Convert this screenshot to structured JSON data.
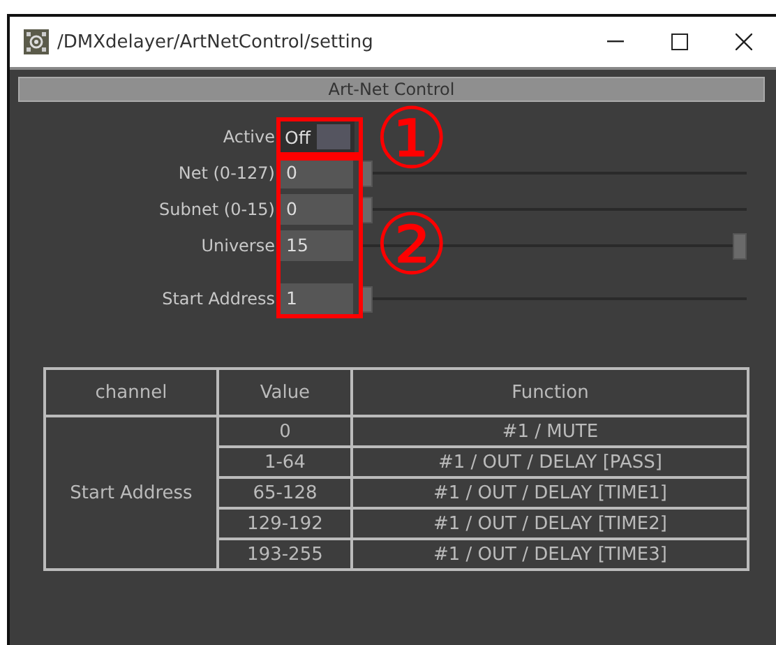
{
  "window": {
    "title": "/DMXdelayer/ArtNetControl/setting"
  },
  "panel": {
    "title": "Art-Net Control"
  },
  "active": {
    "label": "Active",
    "value": "Off",
    "on": false
  },
  "fields": [
    {
      "label": "Net (0-127)",
      "value": "0",
      "level": 0
    },
    {
      "label": "Subnet (0-15)",
      "value": "0",
      "level": 0
    },
    {
      "label": "Universe",
      "value": "15",
      "level": 1
    },
    {
      "label": "Start Address",
      "value": "1",
      "level": 0
    }
  ],
  "table": {
    "columns": [
      "channel",
      "Value",
      "Function"
    ],
    "group": "Start Address",
    "rows": [
      {
        "value": "0",
        "function": "#1 / MUTE"
      },
      {
        "value": "1-64",
        "function": "#1 / OUT / DELAY [PASS]"
      },
      {
        "value": "65-128",
        "function": "#1 / OUT / DELAY [TIME1]"
      },
      {
        "value": "129-192",
        "function": "#1 / OUT / DELAY [TIME2]"
      },
      {
        "value": "193-255",
        "function": "#1 / OUT / DELAY [TIME3]"
      }
    ]
  },
  "annotations": [
    {
      "label": "①"
    },
    {
      "label": "②"
    }
  ]
}
